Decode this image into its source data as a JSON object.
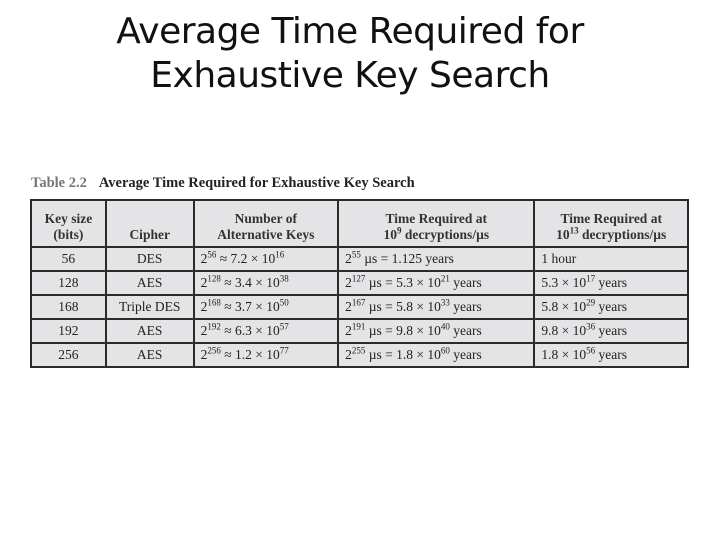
{
  "slide": {
    "title_line1": "Average Time Required for",
    "title_line2": "Exhaustive Key Search"
  },
  "table": {
    "caption_number": "Table 2.2",
    "caption_text": "Average Time Required for Exhaustive Key Search",
    "headers": [
      {
        "line1": "Key size",
        "line2": "(bits)"
      },
      {
        "line1": "",
        "line2": "Cipher"
      },
      {
        "line1": "Number of",
        "line2": "Alternative Keys"
      },
      {
        "line1": "Time Required at",
        "line2_base": "10",
        "line2_exp": "9",
        "line2_rest": " decryptions/µs"
      },
      {
        "line1": "Time Required at",
        "line2_base": "10",
        "line2_exp": "13",
        "line2_rest": " decryptions/µs"
      }
    ],
    "rows": [
      {
        "key_size": "56",
        "cipher": "DES",
        "keys_exp": "56",
        "keys_mant": "7.2",
        "keys_pow": "16",
        "t9_exp": "55",
        "t9_text": "µs = 1.125 years",
        "t9_pow": "",
        "t9_after": "",
        "t13_text": "1 hour",
        "t13_pow": "",
        "t13_after": ""
      },
      {
        "key_size": "128",
        "cipher": "AES",
        "keys_exp": "128",
        "keys_mant": "3.4",
        "keys_pow": "38",
        "t9_exp": "127",
        "t9_text": "µs = 5.3 × 10",
        "t9_pow": "21",
        "t9_after": " years",
        "t13_text": "5.3 × 10",
        "t13_pow": "17",
        "t13_after": " years"
      },
      {
        "key_size": "168",
        "cipher": "Triple DES",
        "keys_exp": "168",
        "keys_mant": "3.7",
        "keys_pow": "50",
        "t9_exp": "167",
        "t9_text": "µs = 5.8 × 10",
        "t9_pow": "33",
        "t9_after": " years",
        "t13_text": "5.8 × 10",
        "t13_pow": "29",
        "t13_after": " years"
      },
      {
        "key_size": "192",
        "cipher": "AES",
        "keys_exp": "192",
        "keys_mant": "6.3",
        "keys_pow": "57",
        "t9_exp": "191",
        "t9_text": "µs = 9.8 × 10",
        "t9_pow": "40",
        "t9_after": " years",
        "t13_text": "9.8 × 10",
        "t13_pow": "36",
        "t13_after": " years"
      },
      {
        "key_size": "256",
        "cipher": "AES",
        "keys_exp": "256",
        "keys_mant": "1.2",
        "keys_pow": "77",
        "t9_exp": "255",
        "t9_text": "µs = 1.8 × 10",
        "t9_pow": "60",
        "t9_after": " years",
        "t13_text": "1.8 × 10",
        "t13_pow": "56",
        "t13_after": " years"
      }
    ]
  }
}
